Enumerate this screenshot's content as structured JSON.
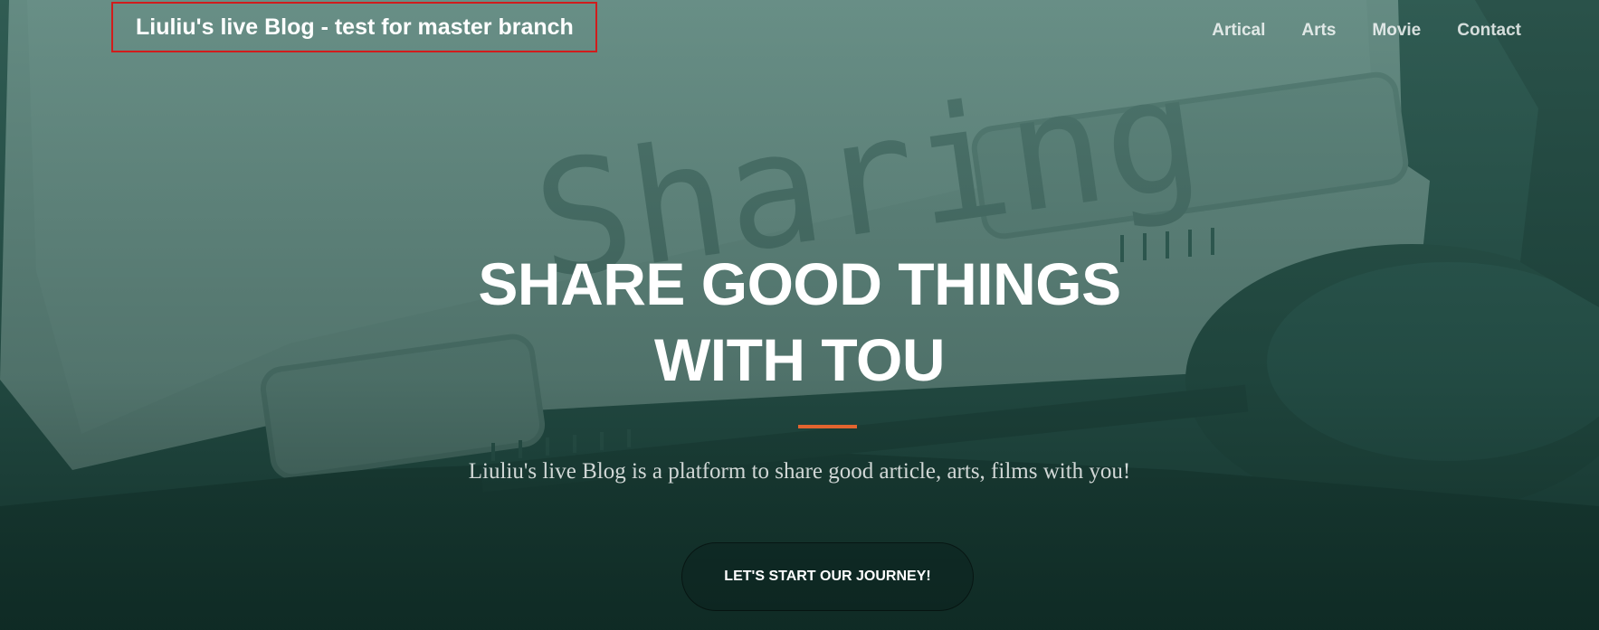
{
  "navbar": {
    "brand": "Liuliu's live Blog - test for master branch",
    "links": [
      "Artical",
      "Arts",
      "Movie",
      "Contact"
    ]
  },
  "hero": {
    "headline_line1": "SHARE GOOD THINGS",
    "headline_line2": "WITH TOU",
    "subtitle": "Liuliu's live Blog is a platform to share good article, arts, films with you!",
    "cta_label": "LET'S START OUR JOURNEY!",
    "background_typed_word": "Sharing",
    "background_image": "typewriter-photo",
    "accent_color": "#e2642f",
    "overlay_color": "#2f5f55"
  }
}
